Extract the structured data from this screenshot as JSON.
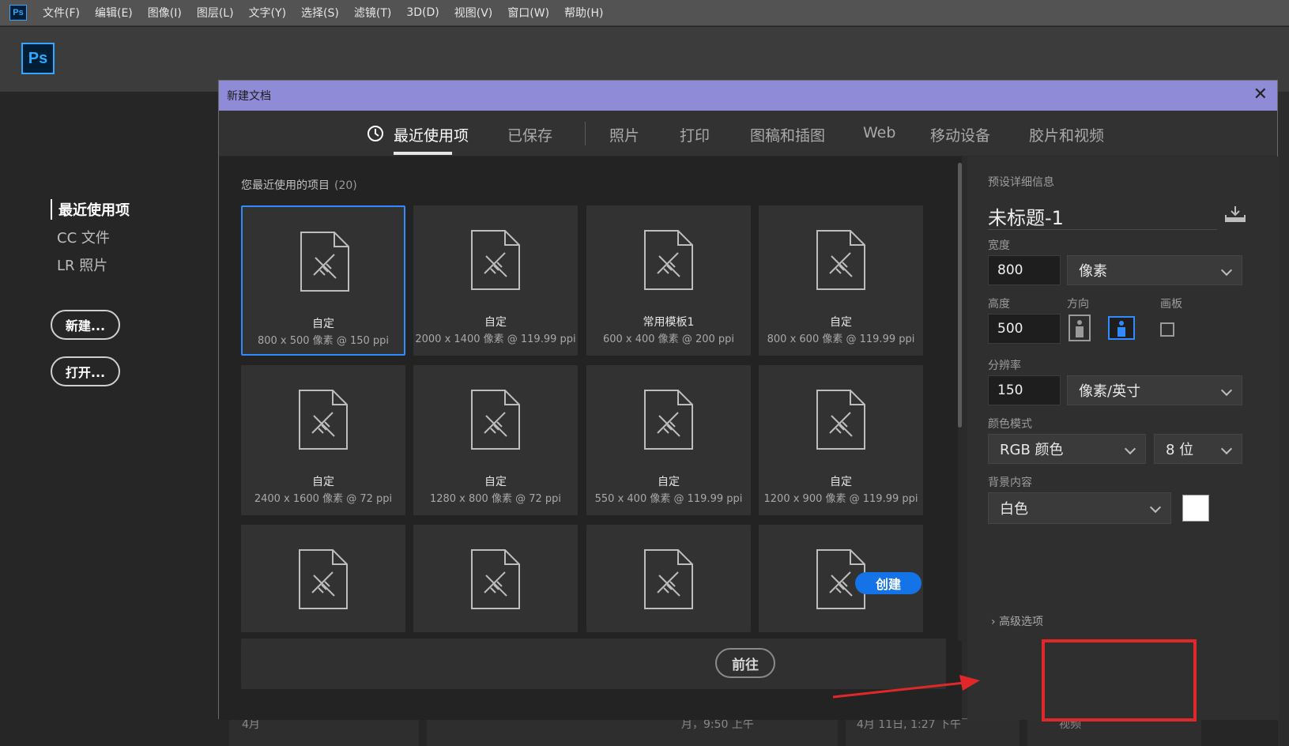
{
  "app": {
    "logo": "Ps"
  },
  "menu": [
    "文件(F)",
    "编辑(E)",
    "图像(I)",
    "图层(L)",
    "文字(Y)",
    "选择(S)",
    "滤镜(T)",
    "3D(D)",
    "视图(V)",
    "窗口(W)",
    "帮助(H)"
  ],
  "home": {
    "nav": [
      "最近使用项",
      "CC 文件",
      "LR 照片"
    ],
    "new_button": "新建...",
    "open_button": "打开..."
  },
  "background_dates": [
    "4月",
    "月，9:50 上午",
    "4月 11日, 1:27 下午",
    "视频"
  ],
  "dialog": {
    "title": "新建文档",
    "tabs": [
      "最近使用项",
      "已保存",
      "照片",
      "打印",
      "图稿和插图",
      "Web",
      "移动设备",
      "胶片和视频"
    ],
    "recent_label": "您最近使用的项目",
    "recent_count": "(20)",
    "presets": [
      {
        "name": "自定",
        "dims": "800 x 500 像素 @ 150 ppi"
      },
      {
        "name": "自定",
        "dims": "2000 x 1400 像素 @ 119.99 ppi"
      },
      {
        "name": "常用模板1",
        "dims": "600 x 400 像素 @ 200 ppi"
      },
      {
        "name": "自定",
        "dims": "800 x 600 像素 @ 119.99 ppi"
      },
      {
        "name": "自定",
        "dims": "2400 x 1600 像素 @ 72 ppi"
      },
      {
        "name": "自定",
        "dims": "1280 x 800 像素 @ 72 ppi"
      },
      {
        "name": "自定",
        "dims": "550 x 400 像素 @ 119.99 ppi"
      },
      {
        "name": "自定",
        "dims": "1200 x 900 像素 @ 119.99 ppi"
      }
    ],
    "goto_button": "前往",
    "details": {
      "header": "预设详细信息",
      "doc_title": "未标题-1",
      "width_label": "宽度",
      "width_value": "800",
      "width_unit": "像素",
      "height_label": "高度",
      "height_value": "500",
      "orientation_label": "方向",
      "artboard_label": "画板",
      "resolution_label": "分辨率",
      "resolution_value": "150",
      "resolution_unit": "像素/英寸",
      "color_mode_label": "颜色模式",
      "color_mode": "RGB 颜色",
      "bit_depth": "8 位",
      "background_label": "背景内容",
      "background_value": "白色",
      "background_color": "#ffffff",
      "advanced": "高级选项",
      "create_button": "创建"
    }
  },
  "colors": {
    "accent": "#1473e6",
    "selection": "#2f8bff",
    "title_bar": "#8f8bd6",
    "annotation": "#e0282a"
  }
}
